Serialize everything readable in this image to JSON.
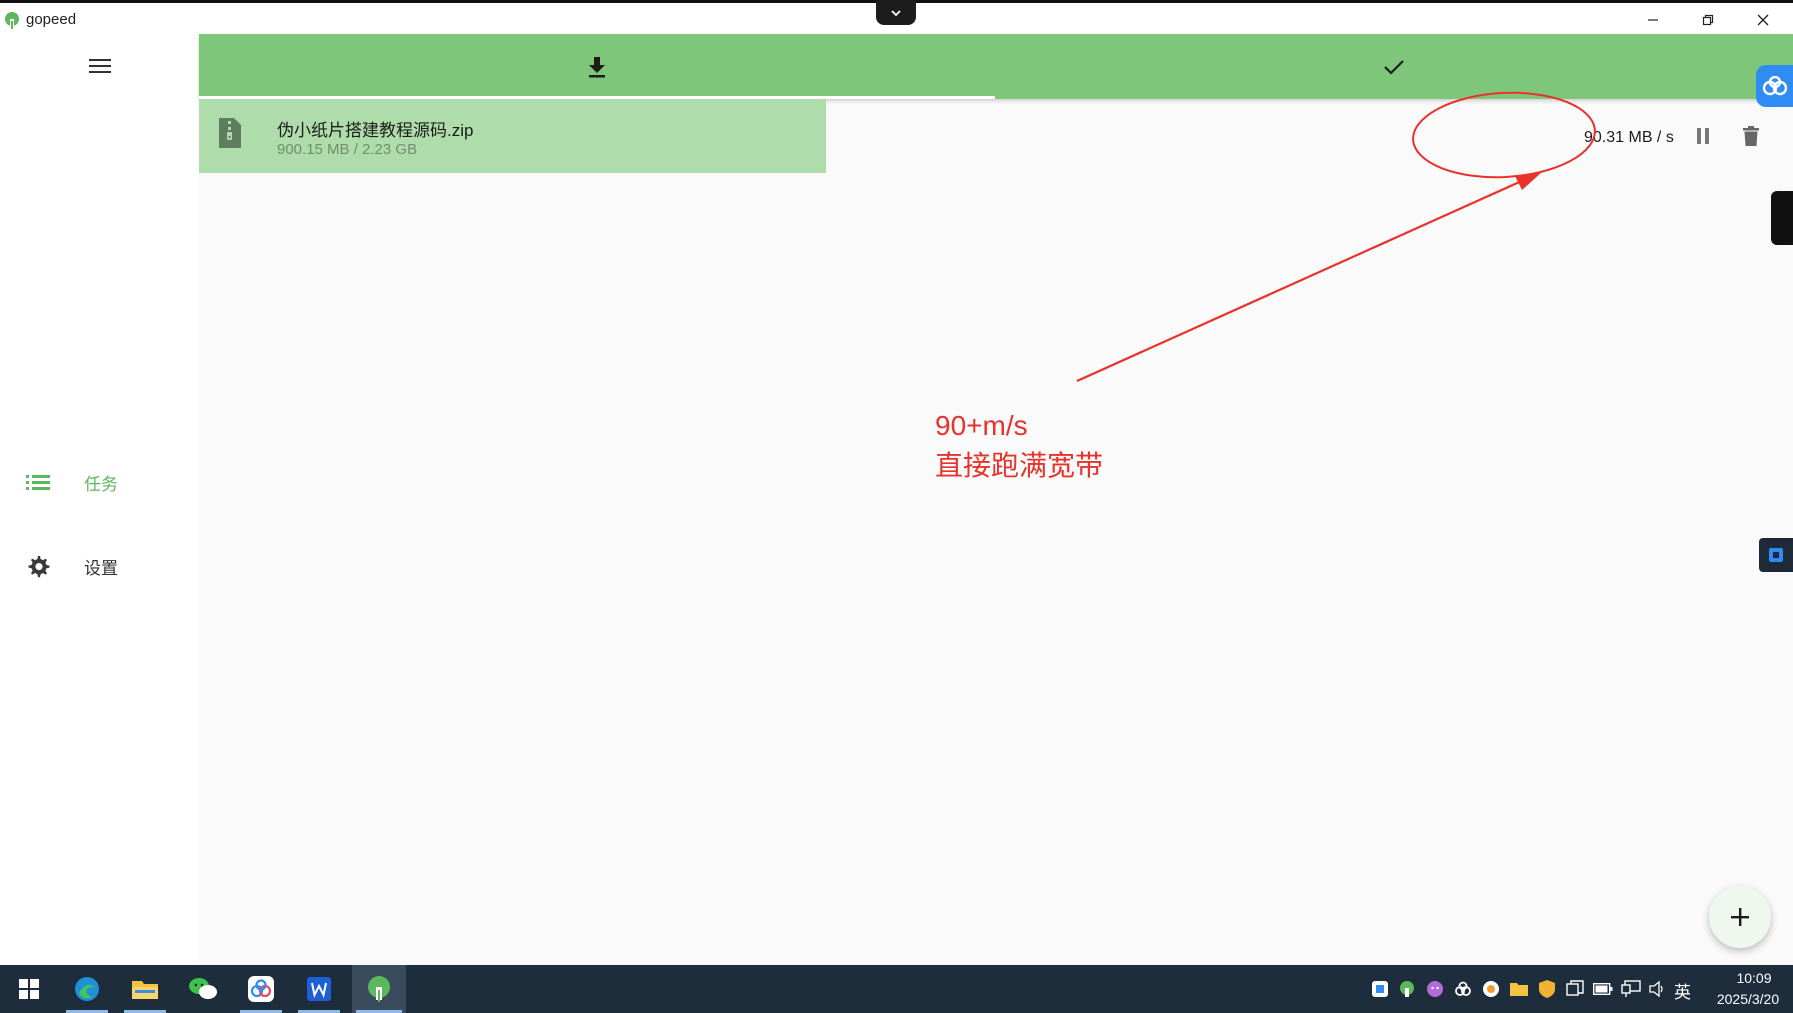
{
  "window": {
    "title": "gopeed"
  },
  "sidebar": {
    "items": [
      {
        "label": "任务",
        "icon": "list-icon",
        "color": "#5cb85c"
      },
      {
        "label": "设置",
        "icon": "gear-icon",
        "color": "#333333"
      }
    ]
  },
  "tabs": [
    {
      "icon": "download-icon",
      "selected": true
    },
    {
      "icon": "check-icon",
      "selected": false
    }
  ],
  "task": {
    "file_name": "伪小纸片搭建教程源码.zip",
    "progress_text": "900.15 MB / 2.23 GB",
    "speed": "90.31 MB / s"
  },
  "annotation": {
    "line1": "90+m/s",
    "line2": "直接跑满宽带",
    "color": "#e8322b"
  },
  "taskbar": {
    "time": "10:09",
    "date": "2025/3/20",
    "ime": "英"
  },
  "colors": {
    "accent": "#7dc67a",
    "selected_row": "#aedcaa"
  }
}
